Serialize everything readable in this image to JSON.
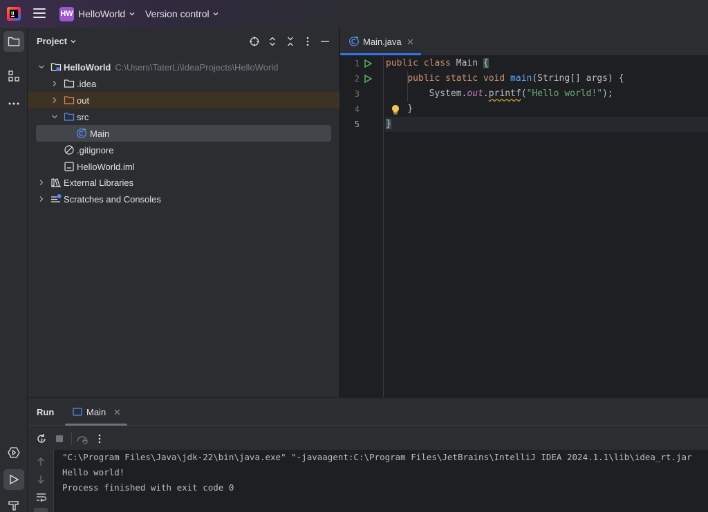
{
  "titlebar": {
    "project_badge": "HW",
    "project_name": "HelloWorld",
    "vcs_label": "Version control"
  },
  "project_panel": {
    "title": "Project",
    "tree": {
      "root_label": "HelloWorld",
      "root_path": "C:\\Users\\TaterLi\\IdeaProjects\\HelloWorld",
      "idea_label": ".idea",
      "out_label": "out",
      "src_label": "src",
      "main_label": "Main",
      "gitignore_label": ".gitignore",
      "iml_label": "HelloWorld.iml",
      "ext_libs_label": "External Libraries",
      "scratches_label": "Scratches and Consoles"
    }
  },
  "editor": {
    "tab_label": "Main.java",
    "line_numbers": [
      "1",
      "2",
      "3",
      "4",
      "5"
    ],
    "code": {
      "l1_kw1": "public",
      "l1_kw2": "class",
      "l1_name": "Main",
      "l1_brace": "{",
      "l2_kw1": "public",
      "l2_kw2": "static",
      "l2_kw3": "void",
      "l2_fn": "main",
      "l2_params": "(String[] args) {",
      "l3_obj": "System.",
      "l3_field": "out",
      "l3_dot": ".",
      "l3_method": "printf",
      "l3_open": "(",
      "l3_str": "\"Hello world!\"",
      "l3_close": ");",
      "l4_brace": "}",
      "l5_brace": "}"
    }
  },
  "run_panel": {
    "title": "Run",
    "tab_label": "Main",
    "console_lines": [
      "\"C:\\Program Files\\Java\\jdk-22\\bin\\java.exe\" \"-javaagent:C:\\Program Files\\JetBrains\\IntelliJ IDEA 2024.1.1\\lib\\idea_rt.jar",
      "Hello world!",
      "Process finished with exit code 0"
    ]
  },
  "colors": {
    "accent": "#3574f0",
    "keyword": "#cf8e6d",
    "function": "#56a8f5",
    "string": "#6aab73",
    "field": "#c77dbb",
    "badge": "#9b59d0"
  }
}
